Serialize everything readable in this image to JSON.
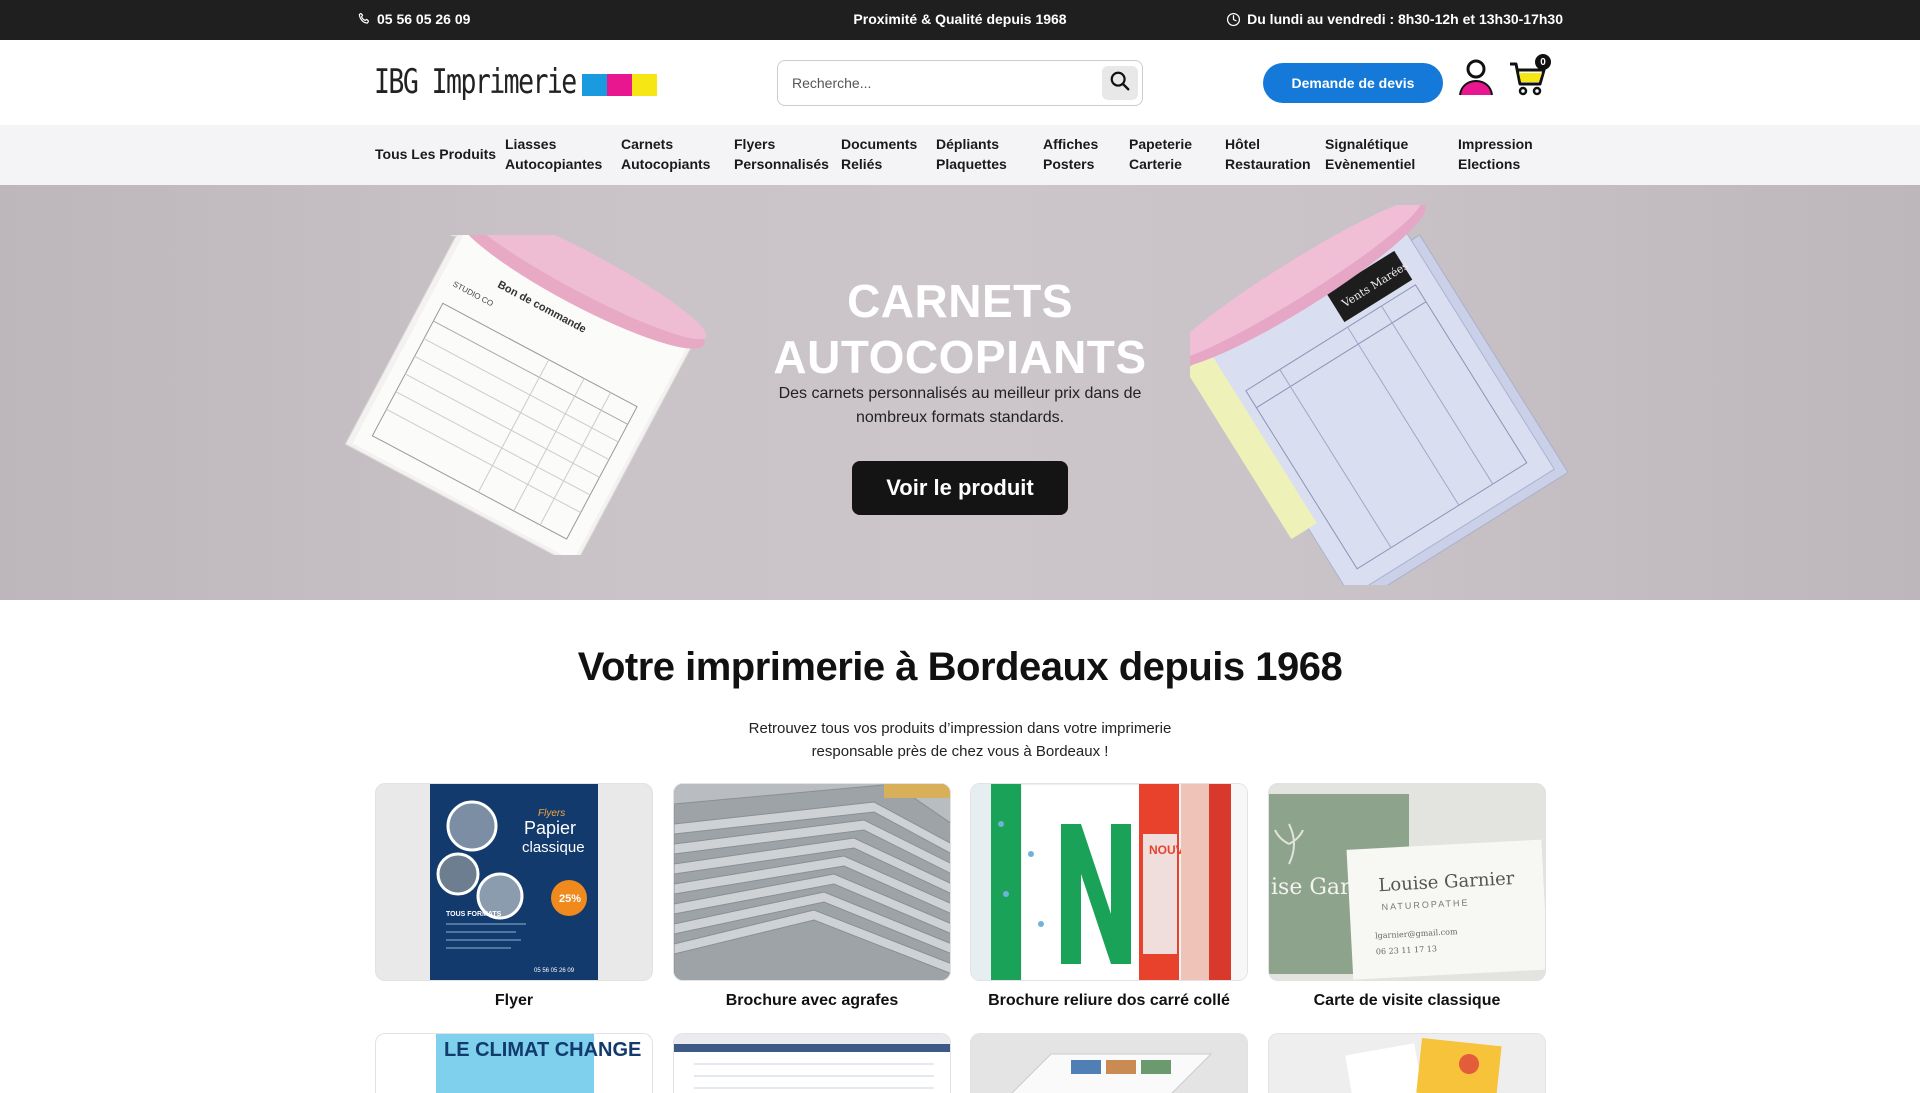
{
  "topbar": {
    "phone": "05 56 05 26 09",
    "tagline": "Proximité & Qualité depuis 1968",
    "hours": "Du lundi au vendredi : 8h30-12h et 13h30-17h30"
  },
  "header": {
    "logo_text": "IBG Imprimerie",
    "logo_colors": [
      "#1a9be0",
      "#e8168f",
      "#f5e614"
    ],
    "search_placeholder": "Recherche...",
    "quote_button": "Demande de devis",
    "cart_count": "0",
    "accent_color": "#1479d8"
  },
  "nav": {
    "items": [
      {
        "line1": "Tous Les Produits",
        "line2": ""
      },
      {
        "line1": "Liasses",
        "line2": "Autocopiantes"
      },
      {
        "line1": "Carnets",
        "line2": "Autocopiants"
      },
      {
        "line1": "Flyers",
        "line2": "Personnalisés"
      },
      {
        "line1": "Documents",
        "line2": "Reliés"
      },
      {
        "line1": "Dépliants",
        "line2": "Plaquettes"
      },
      {
        "line1": "Affiches",
        "line2": "Posters"
      },
      {
        "line1": "Papeterie",
        "line2": "Carterie"
      },
      {
        "line1": "Hôtel",
        "line2": "Restauration"
      },
      {
        "line1": "Signalétique",
        "line2": "Evènementiel"
      },
      {
        "line1": "Impression",
        "line2": "Elections"
      }
    ]
  },
  "hero": {
    "title_line1": "CARNETS",
    "title_line2": "AUTOCOPIANTS",
    "subtitle_line1": "Des carnets personnalisés au meilleur prix dans de",
    "subtitle_line2": "nombreux formats standards.",
    "button": "Voir le produit"
  },
  "intro": {
    "title": "Votre imprimerie à Bordeaux depuis 1968",
    "text_line1": "Retrouvez tous vos produits d’impression dans votre imprimerie",
    "text_line2": "responsable près de chez vous à Bordeaux !"
  },
  "products": [
    {
      "name": "Flyer"
    },
    {
      "name": "Brochure avec agrafes"
    },
    {
      "name": "Brochure reliure dos carré collé"
    },
    {
      "name": "Carte de visite classique"
    }
  ],
  "product_art": {
    "flyer": {
      "title": "Papier",
      "subtitle": "classique",
      "kicker": "Flyers",
      "promo": "25%",
      "formats": "TOUS FORMATS",
      "phone": "05 56 05 26 09"
    },
    "card": {
      "name": "Louise Garnier",
      "role": "NATUROPATHE",
      "email": "lgarnier@gmail.com",
      "phone": "06 23 11 17 13",
      "back_text": "ise Garni"
    },
    "climat": "LE CLIMAT CHANGE"
  }
}
